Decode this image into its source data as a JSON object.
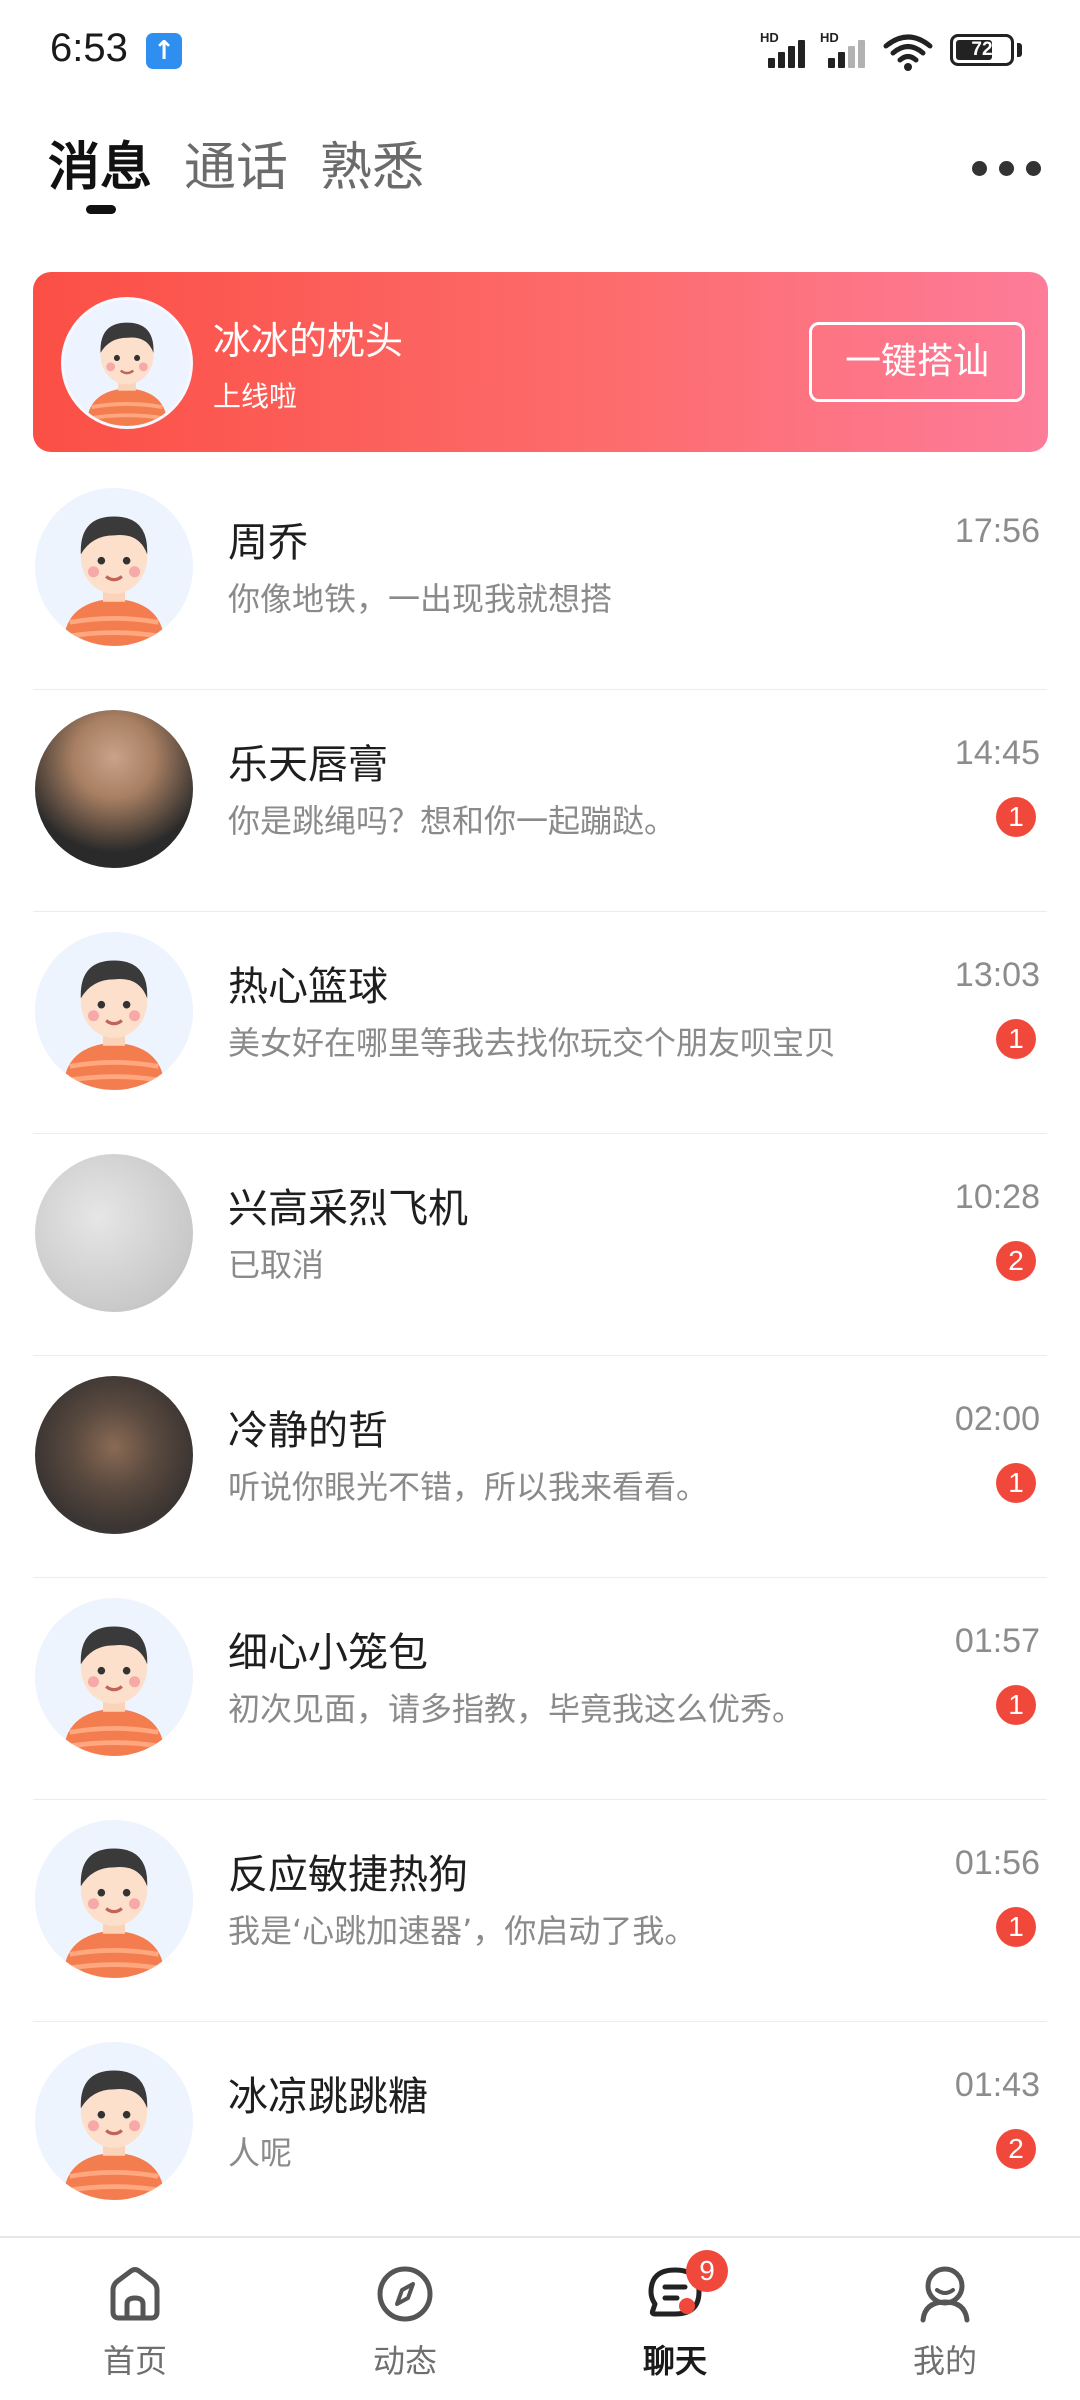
{
  "status_bar": {
    "time": "6:53",
    "signal1_label": "HD",
    "signal2_label": "HD",
    "battery": "72",
    "battery_fraction": 0.72
  },
  "header": {
    "tabs": [
      {
        "label": "消息",
        "active": true
      },
      {
        "label": "通话",
        "active": false
      },
      {
        "label": "熟悉",
        "active": false
      }
    ],
    "more_icon": "more-horizontal-icon"
  },
  "banner": {
    "name": "冰冰的枕头",
    "subtitle": "上线啦",
    "button_label": "一键搭讪",
    "gradient": [
      "#fb4f45",
      "#fd7c99"
    ]
  },
  "chats": [
    {
      "name": "周乔",
      "message": "你像地铁，一出现我就想搭",
      "time": "17:56",
      "unread": "",
      "avatar": "cartoon"
    },
    {
      "name": "乐天唇膏",
      "message": "你是跳绳吗？想和你一起蹦跶。",
      "time": "14:45",
      "unread": "1",
      "avatar": "photo-man"
    },
    {
      "name": "热心篮球",
      "message": "美女好在哪里等我去找你玩交个朋友呗宝贝",
      "time": "13:03",
      "unread": "1",
      "avatar": "cartoon"
    },
    {
      "name": "兴高采烈飞机",
      "message": "已取消",
      "time": "10:28",
      "unread": "2",
      "avatar": "photo-gray"
    },
    {
      "name": "冷静的哲",
      "message": "听说你眼光不错，所以我来看看。",
      "time": "02:00",
      "unread": "1",
      "avatar": "photo-dark"
    },
    {
      "name": "细心小笼包",
      "message": "初次见面，请多指教，毕竟我这么优秀。",
      "time": "01:57",
      "unread": "1",
      "avatar": "cartoon"
    },
    {
      "name": "反应敏捷热狗",
      "message": "我是‘心跳加速器’，你启动了我。",
      "time": "01:56",
      "unread": "1",
      "avatar": "cartoon"
    },
    {
      "name": "冰凉跳跳糖",
      "message": "人呢",
      "time": "01:43",
      "unread": "2",
      "avatar": "cartoon"
    }
  ],
  "bottom_nav": {
    "items": [
      {
        "label": "首页",
        "icon": "home-icon",
        "active": false
      },
      {
        "label": "动态",
        "icon": "compass-icon",
        "active": false
      },
      {
        "label": "聊天",
        "icon": "chat-icon",
        "active": true,
        "badge": "9"
      },
      {
        "label": "我的",
        "icon": "profile-icon",
        "active": false
      }
    ]
  },
  "colors": {
    "accent_red": "#f0493b",
    "active_text": "#111111",
    "muted_text": "#8a8a8a"
  }
}
